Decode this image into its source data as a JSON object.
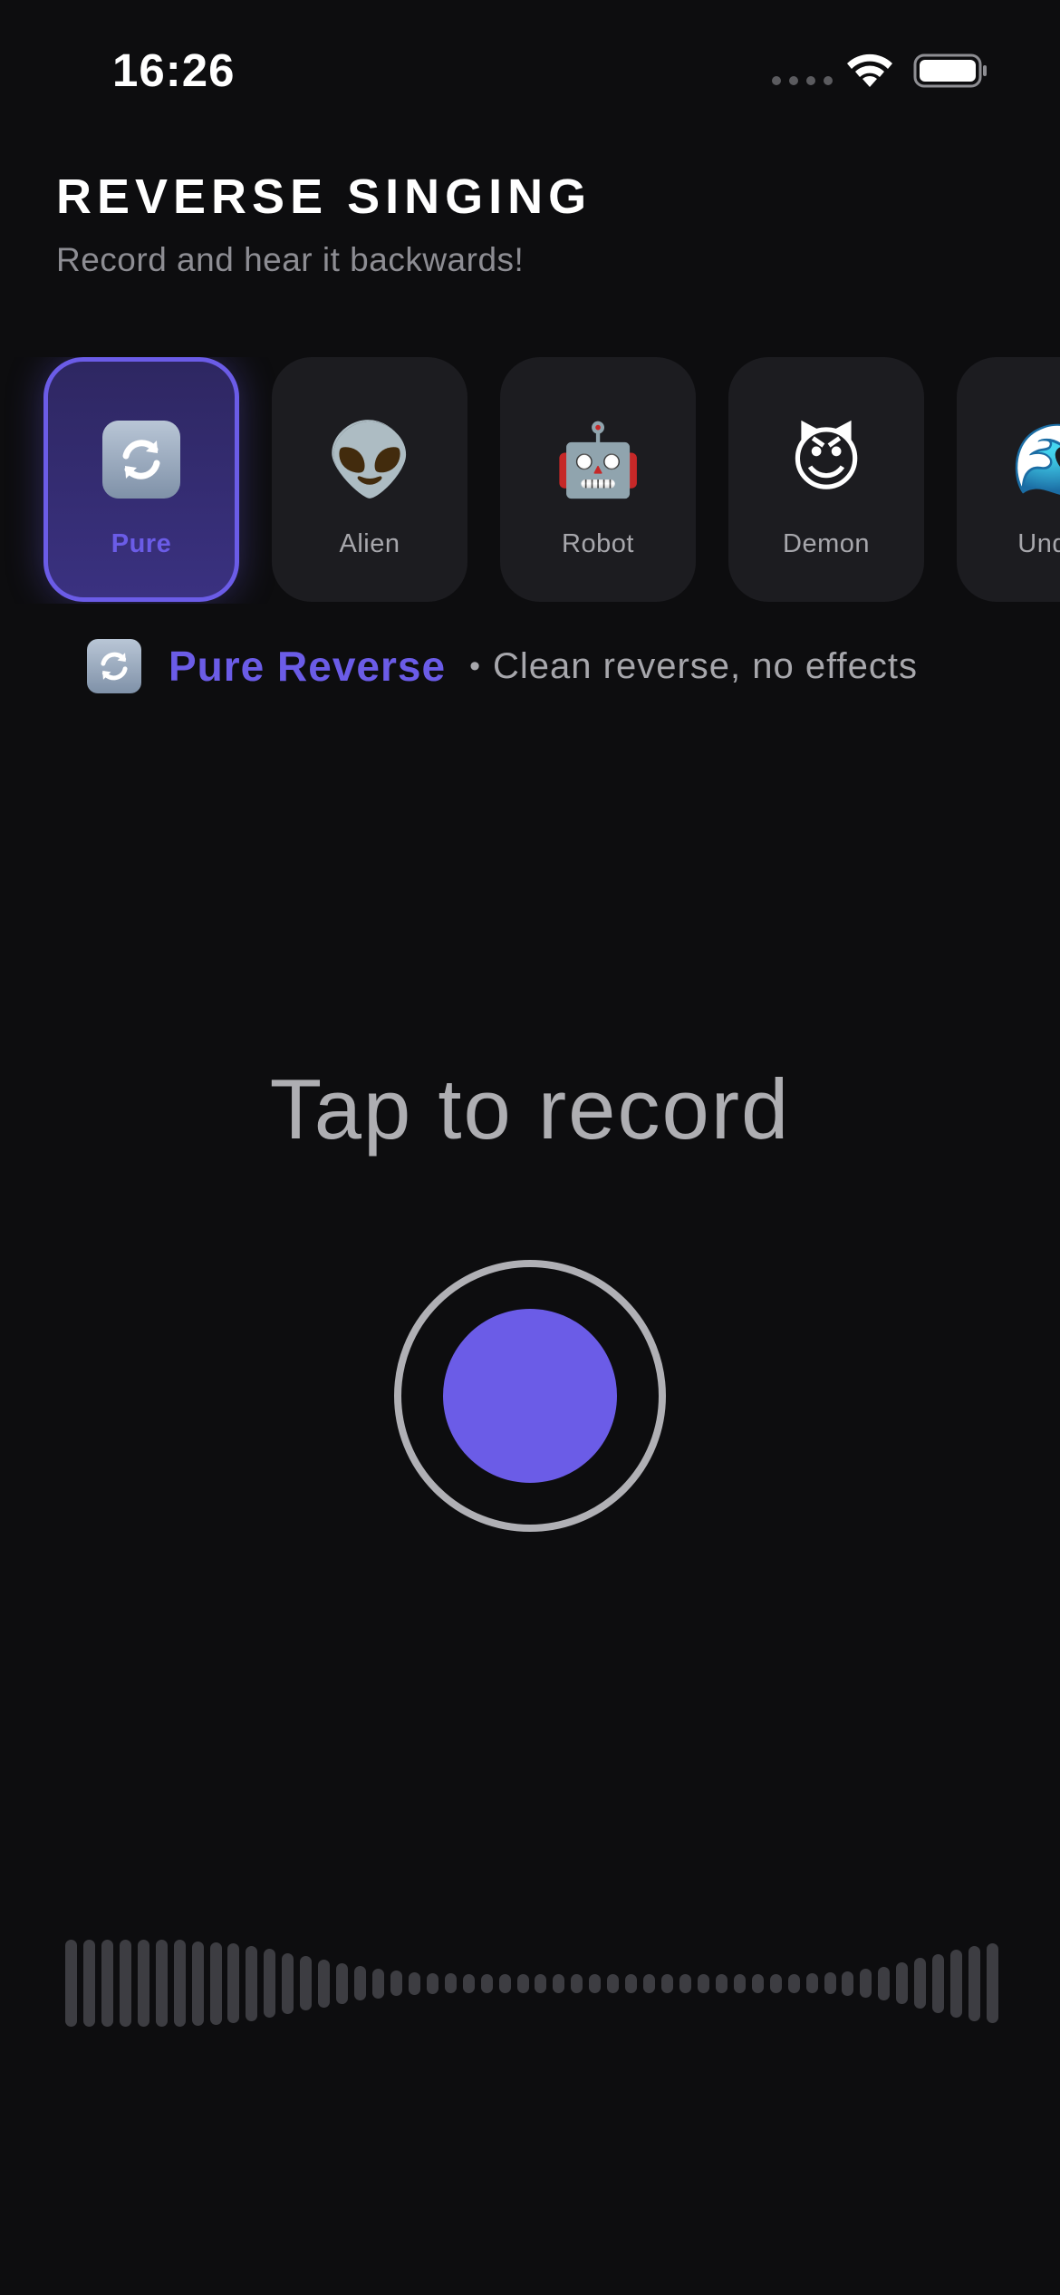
{
  "status_bar": {
    "time": "16:26",
    "icons": [
      "signal-dots-icon",
      "wifi-icon",
      "battery-icon"
    ]
  },
  "header": {
    "title": "REVERSE SINGING",
    "subtitle": "Record and hear it backwards!"
  },
  "effects": [
    {
      "label": "Pure",
      "emoji": "🔄",
      "selected": true
    },
    {
      "label": "Alien",
      "emoji": "👽",
      "selected": false
    },
    {
      "label": "Robot",
      "emoji": "🤖",
      "selected": false
    },
    {
      "label": "Demon",
      "emoji": "😈",
      "selected": false
    },
    {
      "label": "Under",
      "emoji": "🌊",
      "selected": false
    }
  ],
  "selected_effect": {
    "name": "Pure Reverse",
    "separator": "•",
    "description": "Clean reverse, no effects"
  },
  "record": {
    "prompt": "Tap to record"
  },
  "waveform_levels": [
    1,
    1,
    1,
    1,
    1,
    1,
    1,
    0.97,
    0.95,
    0.92,
    0.86,
    0.79,
    0.7,
    0.62,
    0.55,
    0.47,
    0.4,
    0.34,
    0.29,
    0.26,
    0.24,
    0.23,
    0.22,
    0.22,
    0.22,
    0.22,
    0.22,
    0.22,
    0.22,
    0.22,
    0.22,
    0.22,
    0.22,
    0.22,
    0.22,
    0.22,
    0.22,
    0.22,
    0.22,
    0.22,
    0.22,
    0.23,
    0.25,
    0.28,
    0.33,
    0.39,
    0.48,
    0.58,
    0.68,
    0.78,
    0.86,
    0.92
  ],
  "colors": {
    "background": "#0d0d0f",
    "accent": "#6b5ce7",
    "card": "#1c1c20",
    "muted_text": "#a7a7ac",
    "waveform_bar": "#3d3d42"
  }
}
